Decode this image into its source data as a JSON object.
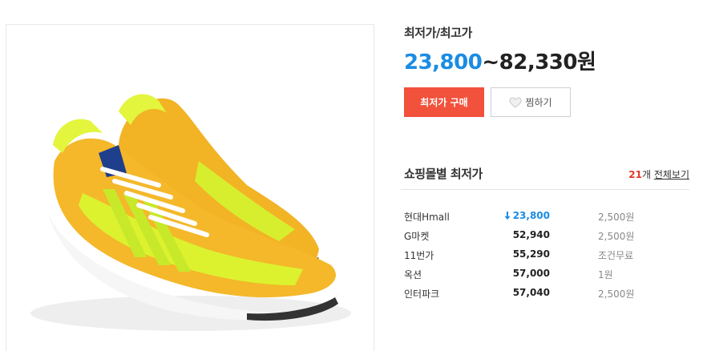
{
  "product": {
    "image_alt": "yellow sneakers"
  },
  "price": {
    "label": "최저가/최고가",
    "min": "23,800",
    "separator": "~",
    "max": "82,330원"
  },
  "buttons": {
    "buy_label": "최저가 구매",
    "wish_label": "찜하기"
  },
  "mall_section": {
    "title": "쇼핑몰별 최저가",
    "count": "21",
    "count_suffix": "개",
    "view_all": "전체보기"
  },
  "malls": [
    {
      "name": "현대Hmall",
      "price": "23,800",
      "shipping": "2,500원"
    },
    {
      "name": "G마켓",
      "price": "52,940",
      "shipping": "2,500원"
    },
    {
      "name": "11번가",
      "price": "55,290",
      "shipping": "조건무료"
    },
    {
      "name": "옥션",
      "price": "57,000",
      "shipping": "1원"
    },
    {
      "name": "인터파크",
      "price": "57,040",
      "shipping": "2,500원"
    }
  ],
  "colors": {
    "accent_blue": "#1a8ce4",
    "buy_red": "#f2513b",
    "count_red": "#e03a2b"
  },
  "icons": {
    "wish": "heart-icon",
    "lowest_marker": "down-arrow-icon"
  }
}
